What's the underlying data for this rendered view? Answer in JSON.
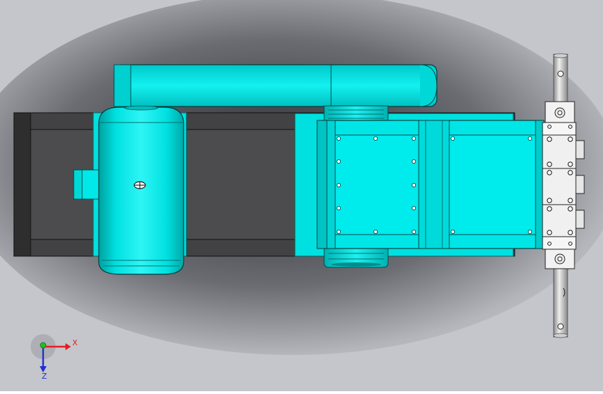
{
  "viewport": {
    "background_color": "#c4c6cc",
    "shadow_color": "#3a3b40"
  },
  "model": {
    "body_color": "#00e6e6",
    "body_dark": "#00b8b8",
    "frame_color": "#3c3c3c",
    "frame_inner": "#555555",
    "manifold_color": "#f2f2f2",
    "pipe_color": "#d0d0d0"
  },
  "triad": {
    "x_label": "X",
    "z_label": "Z",
    "x_color": "#e02020",
    "y_color": "#20c020",
    "z_color": "#2030d0"
  }
}
